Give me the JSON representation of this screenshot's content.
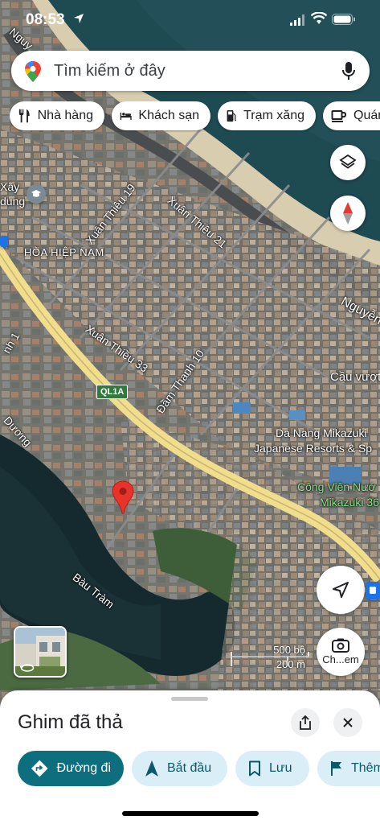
{
  "status_bar": {
    "time": "08:53"
  },
  "search": {
    "placeholder": "Tìm kiếm ở đây"
  },
  "chips": [
    {
      "label": "Nhà hàng",
      "icon": "fork-knife-icon"
    },
    {
      "label": "Khách sạn",
      "icon": "bed-icon"
    },
    {
      "label": "Trạm xăng",
      "icon": "gas-pump-icon"
    },
    {
      "label": "Quán",
      "icon": "coffee-icon"
    }
  ],
  "map_labels": {
    "road_top_left": "Nguy",
    "xay_dung": "Xây",
    "xay_dung2": "dung",
    "xuan_thieu_19": "Xuân Thiều 19",
    "xuan_thieu_21": "Xuân Thiều 21",
    "hoa_hiep_nam": "HÒA HIỆP NAM",
    "nguyen_right": "Nguyễn",
    "xuan_thieu_33": "Xuân Thiều 33",
    "dam_thanh_10": "Đầm Thanh 10",
    "nh1": "nh 1",
    "cau_vuot": "Cầu vượt",
    "ql1a": "QL1A",
    "duong": "Dương",
    "mikazuki_1": "Da Nang Mikazuki",
    "mikazuki_2": "Japanese Resorts & Sp",
    "cong_vien_1": "Công Viên Nướ",
    "cong_vien_2": "Mikazuki 36",
    "bau_tram": "Bàu Tràm"
  },
  "scale": {
    "large": "500 bộ",
    "small": "200 m"
  },
  "camera_button": {
    "label": "Ch...em"
  },
  "sheet": {
    "title": "Ghim đã thả",
    "actions": [
      {
        "label": "Đường đi",
        "icon": "directions-icon"
      },
      {
        "label": "Bắt đầu",
        "icon": "navigation-arrow-icon"
      },
      {
        "label": "Lưu",
        "icon": "bookmark-icon"
      },
      {
        "label": "Thêm",
        "icon": "flag-icon"
      }
    ]
  },
  "colors": {
    "accent": "#0d6f7e",
    "pin": "#e8332a",
    "soft_button": "#d9eef7"
  }
}
